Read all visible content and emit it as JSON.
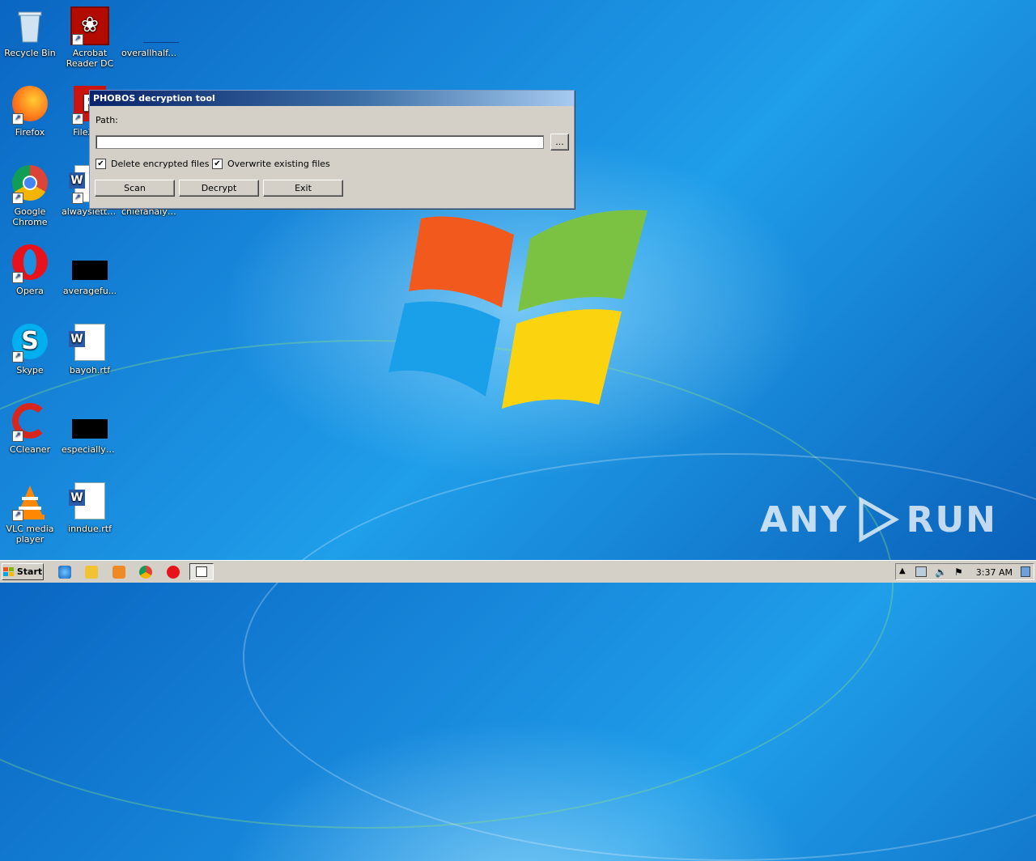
{
  "desktop": {
    "icons": [
      {
        "label": "Recycle Bin",
        "icon": "recycle-bin-icon"
      },
      {
        "label": "Acrobat Reader DC",
        "icon": "acrobat-icon"
      },
      {
        "label": "overallhalf....",
        "icon": "blank-file-icon"
      },
      {
        "label": "Firefox",
        "icon": "firefox-icon"
      },
      {
        "label": "FileZilla",
        "icon": "filezilla-icon"
      },
      {
        "label": "Google Chrome",
        "icon": "chrome-icon"
      },
      {
        "label": "alwayslette...",
        "icon": "word-doc-icon"
      },
      {
        "label": "chiefanalysi...",
        "icon": "blank-file-icon"
      },
      {
        "label": "Opera",
        "icon": "opera-icon"
      },
      {
        "label": "averagefu...",
        "icon": "black-file-icon"
      },
      {
        "label": "Skype",
        "icon": "skype-icon"
      },
      {
        "label": "bayoh.rtf",
        "icon": "word-doc-icon"
      },
      {
        "label": "CCleaner",
        "icon": "ccleaner-icon"
      },
      {
        "label": "especiallyh...",
        "icon": "black-file-icon"
      },
      {
        "label": "VLC media player",
        "icon": "vlc-icon"
      },
      {
        "label": "inndue.rtf",
        "icon": "word-doc-icon"
      }
    ]
  },
  "dialog": {
    "title": "PHOBOS decryption tool",
    "path_label": "Path:",
    "path_value": "",
    "browse_label": "...",
    "checkboxes": [
      {
        "label": "Delete encrypted files",
        "checked": true
      },
      {
        "label": "Overwrite existing files",
        "checked": true
      }
    ],
    "buttons": {
      "scan": "Scan",
      "decrypt": "Decrypt",
      "exit": "Exit"
    }
  },
  "taskbar": {
    "start_label": "Start",
    "clock": "3:37 AM",
    "quick_launch": [
      "ie-icon",
      "explorer-icon",
      "media-player-icon",
      "chrome-icon",
      "opera-icon"
    ],
    "active_task": "phobos-tool-icon"
  },
  "watermark": {
    "text_left": "ANY",
    "text_right": "RUN"
  },
  "colors": {
    "desktop_blue": "#1a8fe0",
    "titlebar_start": "#0a246a",
    "titlebar_end": "#a6caf0",
    "dialog_face": "#d4d0c8"
  }
}
